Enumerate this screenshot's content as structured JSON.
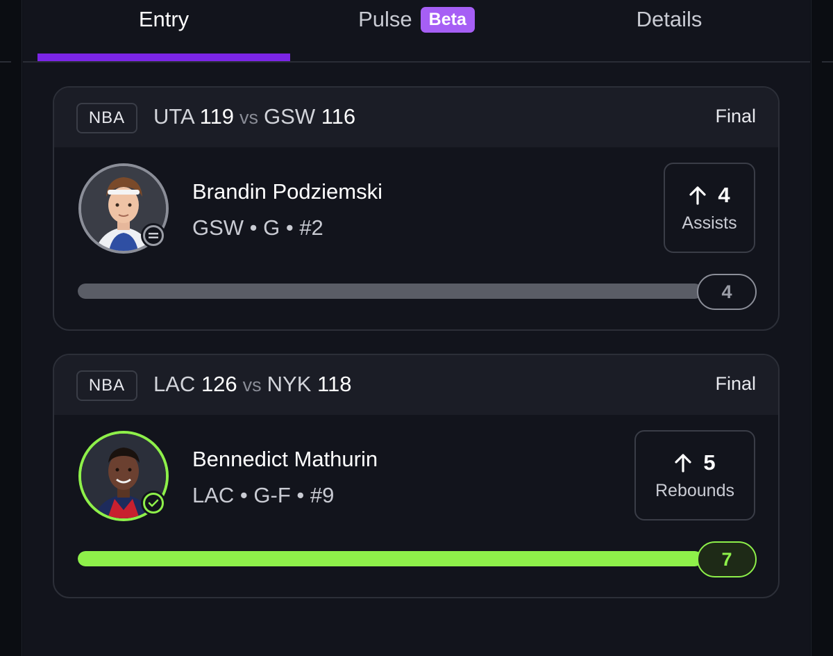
{
  "tabs": {
    "entry": "Entry",
    "pulse": "Pulse",
    "pulse_badge": "Beta",
    "details": "Details"
  },
  "cards": [
    {
      "league": "NBA",
      "team1": "UTA",
      "score1": "119",
      "vs": "vs",
      "team2": "GSW",
      "score2": "116",
      "status": "Final",
      "player_name": "Brandin Podziemski",
      "player_meta": "GSW • G • #2",
      "stat_value": "4",
      "stat_label": "Assists",
      "stat_direction": "up-arrow-icon",
      "progress_value": "4",
      "progress_fraction": 1.0,
      "result_icon": "equals-icon"
    },
    {
      "league": "NBA",
      "team1": "LAC",
      "score1": "126",
      "vs": "vs",
      "team2": "NYK",
      "score2": "118",
      "status": "Final",
      "player_name": "Bennedict Mathurin",
      "player_meta": "LAC • G-F • #9",
      "stat_value": "5",
      "stat_label": "Rebounds",
      "stat_direction": "up-arrow-icon",
      "progress_value": "7",
      "progress_fraction": 1.0,
      "result_icon": "check-icon"
    }
  ],
  "colors": {
    "accent": "#7b25e6",
    "beta_badge": "#a65ff5",
    "success": "#8ef04a",
    "neutral": "#8b8e98",
    "background": "#12141c"
  }
}
